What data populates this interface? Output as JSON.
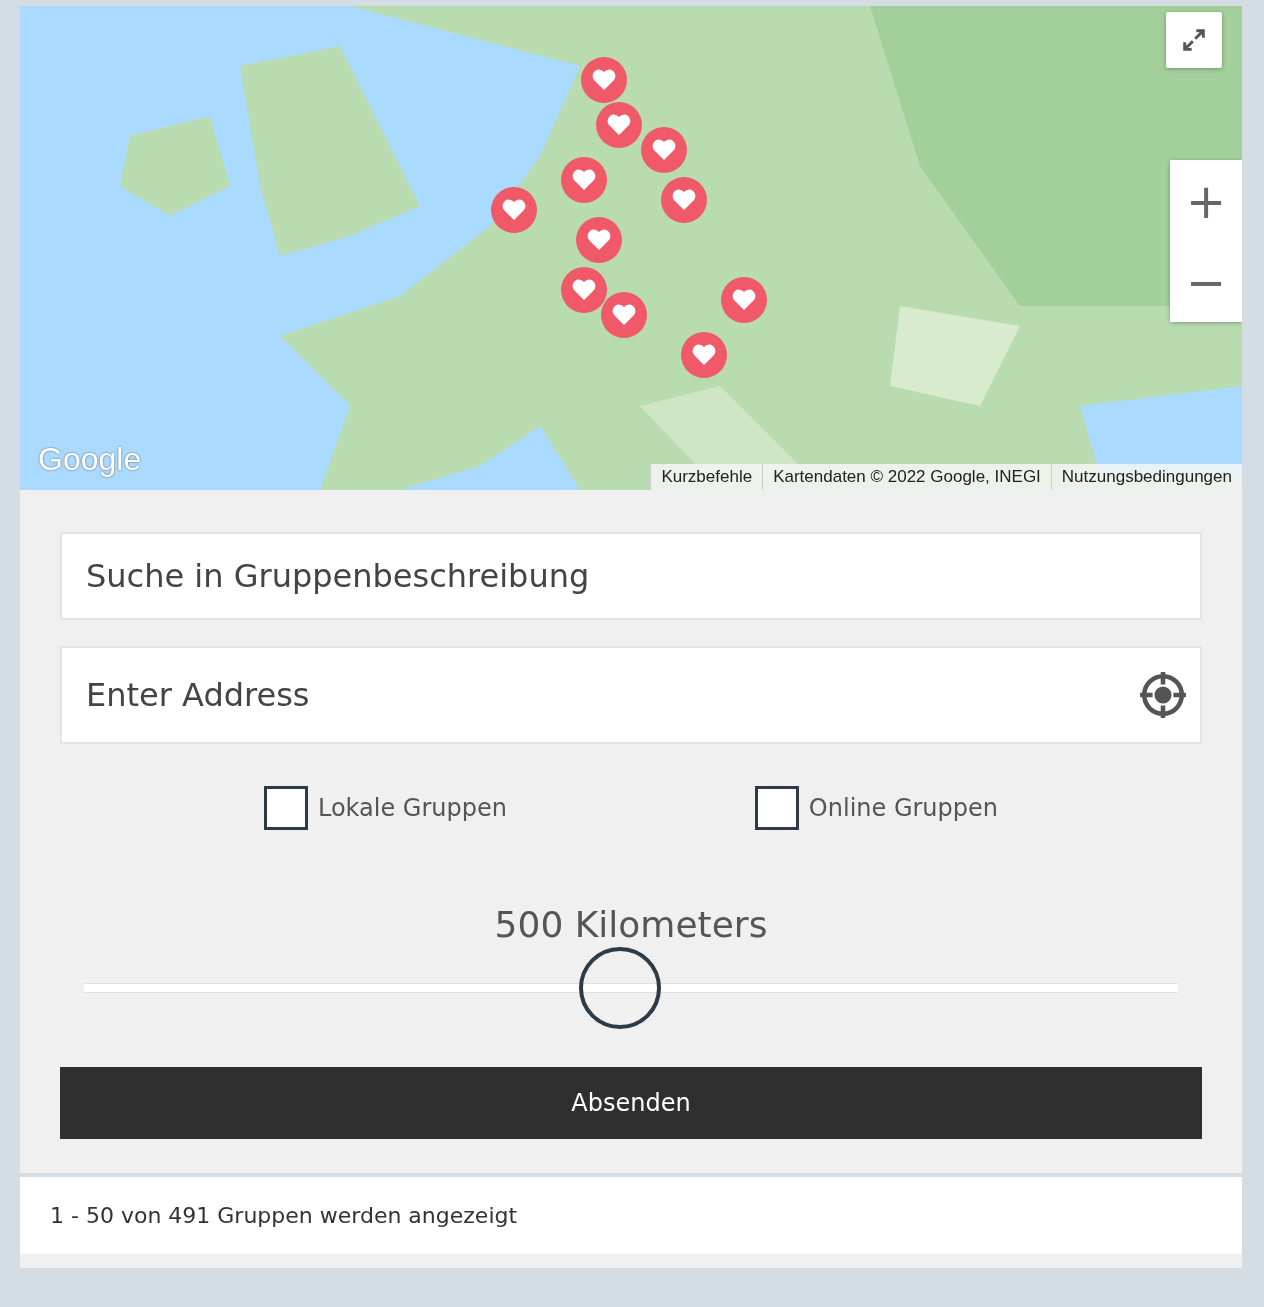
{
  "map": {
    "logo": "Google",
    "attribution": [
      "Kurzbefehle",
      "Kartendaten © 2022 Google, INEGI",
      "Nutzungsbedingungen"
    ],
    "zoom_in": "+",
    "zoom_out": "−"
  },
  "search": {
    "placeholder": "Suche in Gruppenbeschreibung"
  },
  "address": {
    "placeholder": "Enter Address"
  },
  "filters": [
    {
      "label": "Lokale Gruppen",
      "checked": false
    },
    {
      "label": "Online Gruppen",
      "checked": false
    }
  ],
  "radius": {
    "label": "500 Kilometers",
    "level": 0.49
  },
  "submit": "Absenden",
  "results": "1 - 50 von 491 Gruppen werden angezeigt"
}
